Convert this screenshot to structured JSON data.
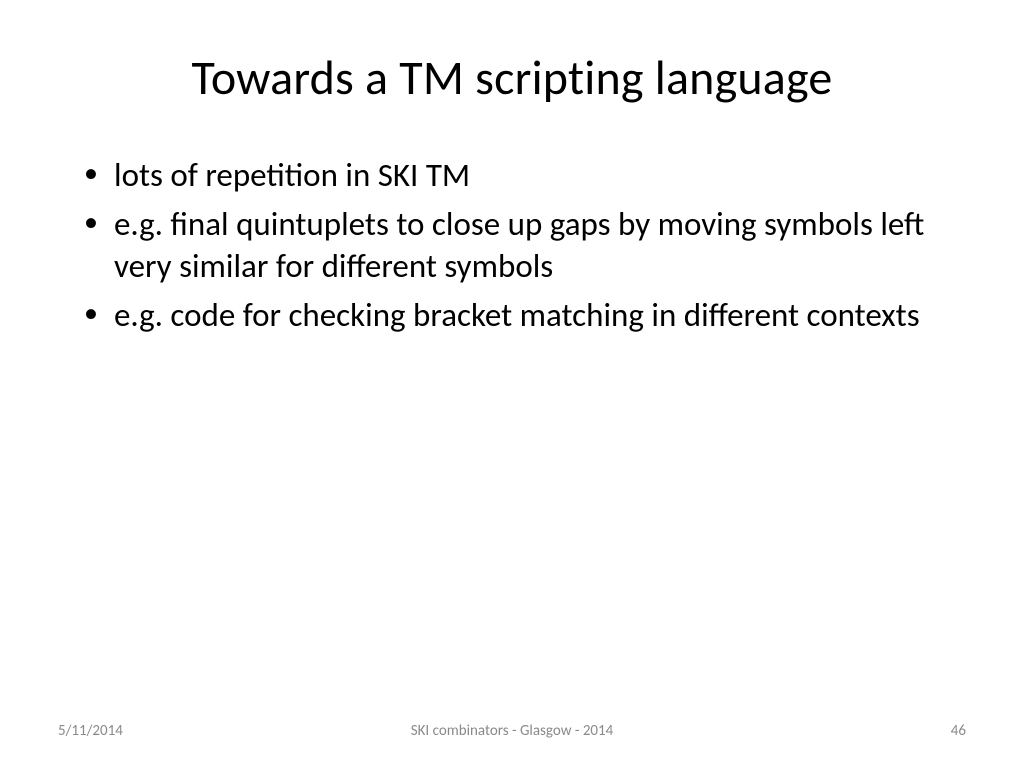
{
  "title": "Towards a TM scripting language",
  "bullets": [
    "lots of repetition in SKI TM",
    "e.g. final quintuplets to close up gaps by moving symbols left very similar for different symbols",
    "e.g. code for checking bracket matching in different contexts"
  ],
  "footer": {
    "date": "5/11/2014",
    "presentation": "SKI combinators - Glasgow - 2014",
    "page": "46"
  }
}
